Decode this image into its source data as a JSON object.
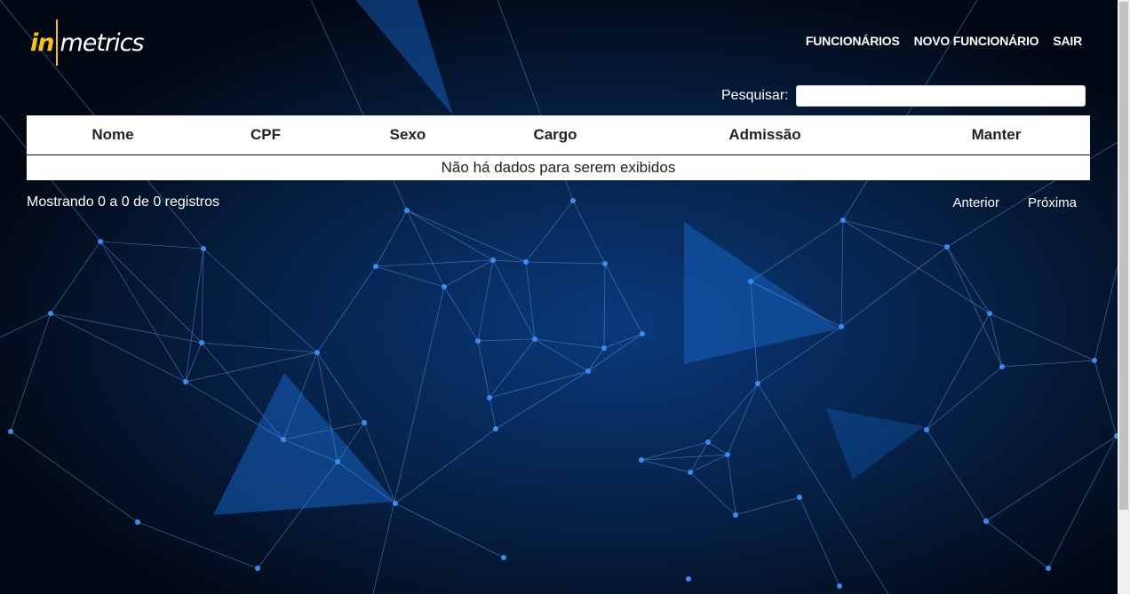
{
  "logo": {
    "prefix": "in",
    "suffix": "metrics"
  },
  "nav": {
    "items": [
      {
        "label": "FUNCIONÁRIOS"
      },
      {
        "label": "NOVO FUNCIONÁRIO"
      },
      {
        "label": "SAIR"
      }
    ]
  },
  "search": {
    "label": "Pesquisar:",
    "value": ""
  },
  "table": {
    "columns": [
      "Nome",
      "CPF",
      "Sexo",
      "Cargo",
      "Admissão",
      "Manter"
    ],
    "empty_message": "Não há dados para serem exibidos"
  },
  "footer": {
    "info": "Mostrando 0 a 0 de 0 registros",
    "prev_label": "Anterior",
    "next_label": "Próxima"
  },
  "colors": {
    "background": "#020813",
    "network_line": "#4d8fe0",
    "network_node": "#3a8cf0",
    "logo_accent": "#f5c125"
  }
}
